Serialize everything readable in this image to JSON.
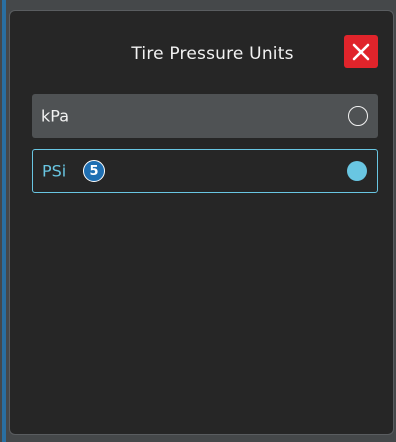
{
  "dialog": {
    "title": "Tire Pressure Units",
    "close_icon": "close-x-icon"
  },
  "options": [
    {
      "label": "kPa",
      "selected": false
    },
    {
      "label": "PSi",
      "selected": true,
      "badge": "5"
    }
  ],
  "colors": {
    "accent": "#69c6e2",
    "close_button": "#e0242b",
    "badge": "#1f6fb2",
    "dialog_background": "#262626",
    "option_background": "#4f5254"
  }
}
